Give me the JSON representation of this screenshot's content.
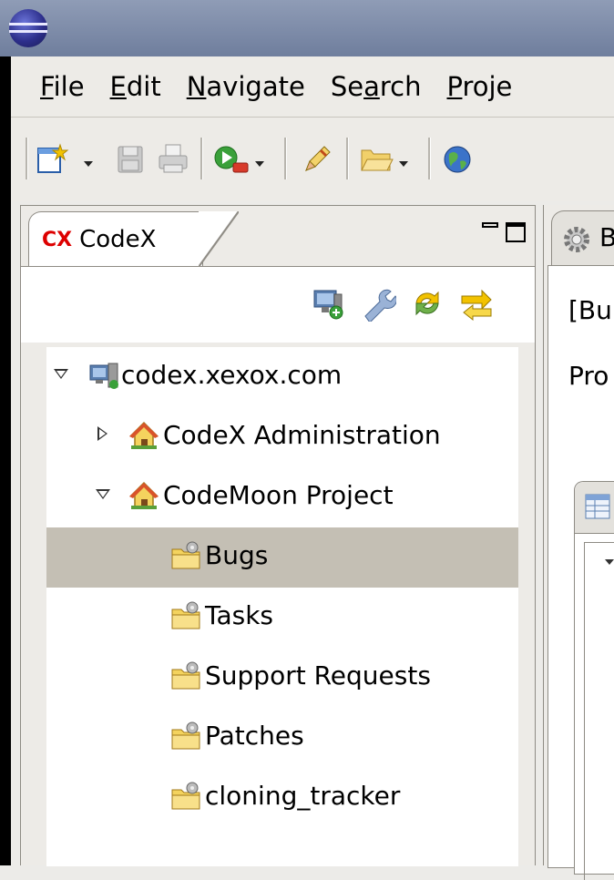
{
  "menubar": {
    "items": [
      {
        "label": "File",
        "mnemonic": "F",
        "rest": "ile"
      },
      {
        "label": "Edit",
        "mnemonic": "E",
        "rest": "dit"
      },
      {
        "label": "Navigate",
        "mnemonic": "N",
        "rest": "avigate"
      },
      {
        "label": "Search",
        "pre": "Se",
        "mnemonic": "a",
        "rest": "rch"
      },
      {
        "label": "Project",
        "mnemonic": "P",
        "rest": "roje"
      }
    ]
  },
  "view": {
    "title": "CodeX",
    "logo_text": "CX"
  },
  "tree": {
    "root": "codex.xexox.com",
    "projects": [
      {
        "label": "CodeX Administration",
        "expanded": false
      },
      {
        "label": "CodeMoon Project",
        "expanded": true
      }
    ],
    "trackers": [
      "Bugs",
      "Tasks",
      "Support Requests",
      "Patches",
      "cloning_tracker"
    ],
    "selected": "Bugs"
  },
  "editor": {
    "tab_label": "B",
    "line1": "[Bu",
    "line2": "Pro"
  },
  "colors": {
    "selection": "#c4bfb4",
    "logo_red": "#dd0000",
    "folder_yellow": "#f4d35e"
  }
}
